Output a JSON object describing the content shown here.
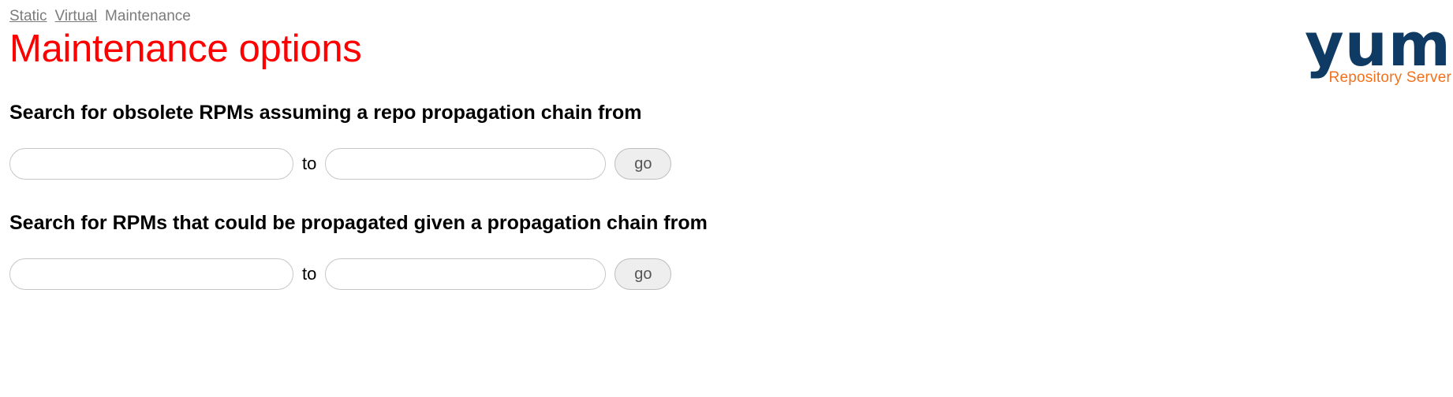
{
  "nav": {
    "items": [
      {
        "label": "Static",
        "is_link": true,
        "name": "nav-link-static"
      },
      {
        "label": "Virtual",
        "is_link": true,
        "name": "nav-link-virtual"
      },
      {
        "label": "Maintenance",
        "is_link": false,
        "name": "nav-current-maintenance"
      }
    ]
  },
  "header": {
    "title": "Maintenance options",
    "title_color": "#ff0000"
  },
  "logo": {
    "word": "yum",
    "subtitle": "Repository Server",
    "word_color": "#0e3a63",
    "subtitle_color": "#f2711c"
  },
  "sections": [
    {
      "heading": "Search for obsolete RPMs assuming a repo propagation chain from",
      "from_value": "",
      "from_placeholder": "",
      "separator_label": "to",
      "to_value": "",
      "to_placeholder": "",
      "submit_label": "go"
    },
    {
      "heading": "Search for RPMs that could be propagated given a propagation chain from",
      "from_value": "",
      "from_placeholder": "",
      "separator_label": "to",
      "to_value": "",
      "to_placeholder": "",
      "submit_label": "go"
    }
  ]
}
